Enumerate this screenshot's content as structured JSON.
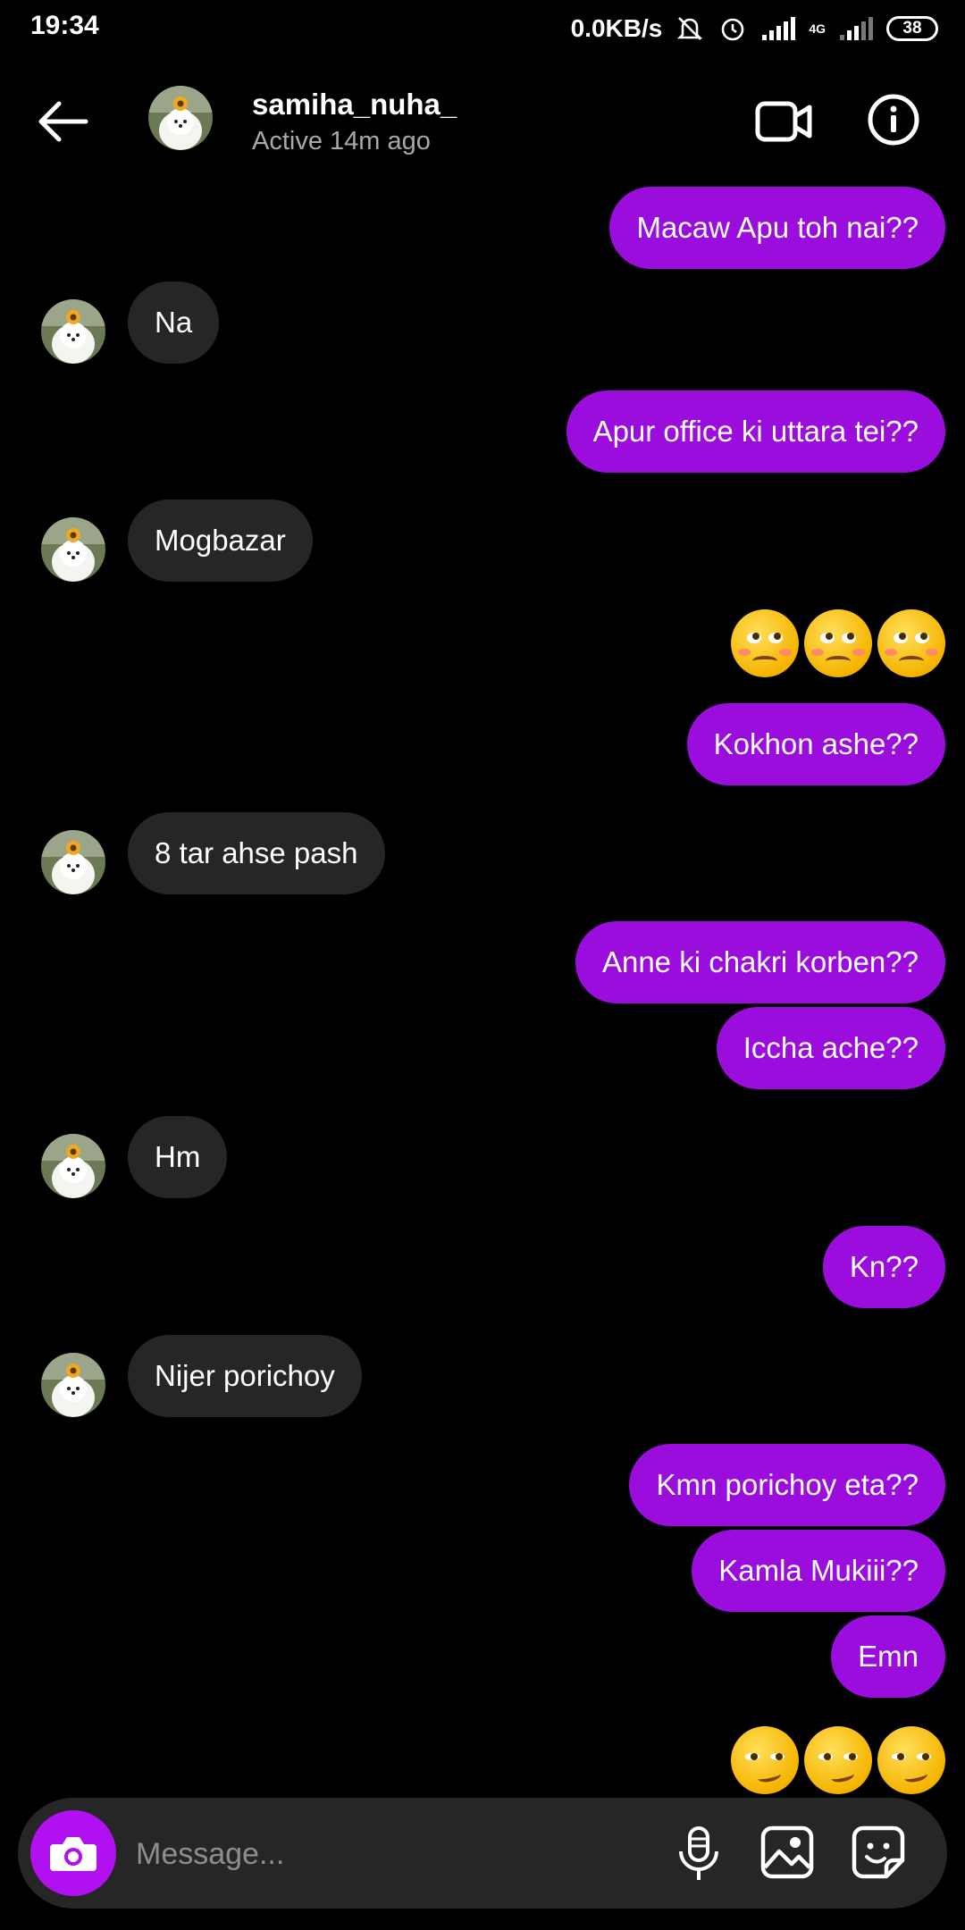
{
  "status_bar": {
    "time": "19:34",
    "net_speed": "0.0KB/s",
    "network_label": "4G",
    "battery": "38"
  },
  "header": {
    "username": "samiha_nuha_",
    "activity": "Active 14m ago"
  },
  "messages": [
    {
      "side": "out",
      "text": "Macaw Apu toh nai??"
    },
    {
      "side": "in",
      "text": "Na"
    },
    {
      "side": "out",
      "text": "Apur office ki uttara tei??"
    },
    {
      "side": "in",
      "text": "Mogbazar"
    },
    {
      "side": "out",
      "emoji": "face-with-rolling-eyes",
      "count": 3
    },
    {
      "side": "out",
      "text": "Kokhon ashe??"
    },
    {
      "side": "in",
      "text": "8 tar ahse pash"
    },
    {
      "side": "out",
      "text": "Anne ki chakri korben??"
    },
    {
      "side": "out",
      "text": "Iccha ache??"
    },
    {
      "side": "in",
      "text": "Hm"
    },
    {
      "side": "out",
      "text": "Kn??"
    },
    {
      "side": "in",
      "text": "Nijer porichoy"
    },
    {
      "side": "out",
      "text": "Kmn porichoy eta??"
    },
    {
      "side": "out",
      "text": "Kamla Mukiii??"
    },
    {
      "side": "out",
      "text": "Emn"
    },
    {
      "side": "out",
      "emoji": "smirking-face",
      "count": 3
    }
  ],
  "composer": {
    "placeholder": "Message..."
  },
  "colors": {
    "outgoing_bubble": "#9a0ddd",
    "incoming_bubble": "#262626",
    "camera_button": "#b110f0",
    "background": "#000000"
  },
  "icons": [
    "back-arrow-icon",
    "video-call-icon",
    "info-icon",
    "camera-icon",
    "microphone-icon",
    "gallery-icon",
    "sticker-icon",
    "notifications-off-icon",
    "alarm-icon",
    "signal-icon"
  ]
}
